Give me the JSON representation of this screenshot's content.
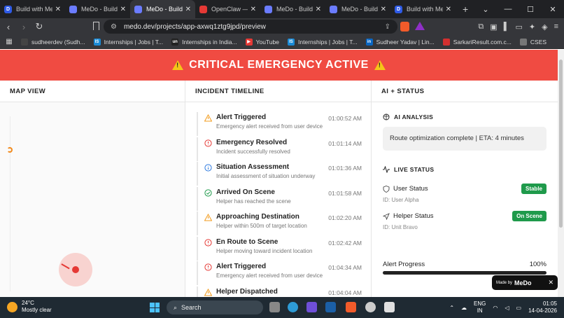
{
  "browser": {
    "tabs": [
      {
        "title": "Build with MeDo |",
        "fav_color": "#2f5be7",
        "fav_letter": "D",
        "active": false
      },
      {
        "title": "MeDo - Build full-",
        "fav_color": "#6b7cff",
        "fav_letter": "",
        "active": false
      },
      {
        "title": "MeDo - Build",
        "fav_color": "#6b7cff",
        "fav_letter": "",
        "active": true
      },
      {
        "title": "OpenClaw — Perso",
        "fav_color": "#e53935",
        "fav_letter": "",
        "active": false
      },
      {
        "title": "MeDo - Build full-",
        "fav_color": "#6b7cff",
        "fav_letter": "",
        "active": false
      },
      {
        "title": "MeDo - Build full-",
        "fav_color": "#6b7cff",
        "fav_letter": "",
        "active": false
      },
      {
        "title": "Build with MeDo |",
        "fav_color": "#2f5be7",
        "fav_letter": "D",
        "active": false
      }
    ],
    "url": "medo.dev/projects/app-axwq1ztg9jpd/preview",
    "bookmarks": [
      {
        "label": "sudheerdev (Sudh...",
        "color": "#444",
        "letter": ""
      },
      {
        "label": "Internships | Jobs | T...",
        "color": "#1a8ad6",
        "letter": "IS"
      },
      {
        "label": "Internships in India...",
        "color": "#222",
        "letter": "un"
      },
      {
        "label": "YouTube",
        "color": "#e53935",
        "letter": "▶"
      },
      {
        "label": "Internships | Jobs | T...",
        "color": "#1a8ad6",
        "letter": "IS"
      },
      {
        "label": "Sudheer Yadav | Lin...",
        "color": "#0a66c2",
        "letter": "in"
      },
      {
        "label": "SarkariResult.com.c...",
        "color": "#d32f2f",
        "letter": ""
      },
      {
        "label": "CSES",
        "color": "#777",
        "letter": ""
      }
    ]
  },
  "banner": {
    "text": "CRITICAL EMERGENCY ACTIVE"
  },
  "panels": {
    "map_title": "MAP VIEW",
    "timeline_title": "INCIDENT TIMELINE",
    "status_title": "AI + STATUS"
  },
  "timeline": [
    {
      "title": "Alert Triggered",
      "desc": "Emergency alert received from user device",
      "time": "01:00:52 AM",
      "icon": "warning-icon",
      "color": "#f29b1c"
    },
    {
      "title": "Emergency Resolved",
      "desc": "Incident successfully resolved",
      "time": "01:01:14 AM",
      "icon": "alert-circle-icon",
      "color": "#e53935"
    },
    {
      "title": "Situation Assessment",
      "desc": "Initial assessment of situation underway",
      "time": "01:01:36 AM",
      "icon": "info-icon",
      "color": "#2f7be0"
    },
    {
      "title": "Arrived On Scene",
      "desc": "Helper has reached the scene",
      "time": "01:01:58 AM",
      "icon": "check-circle-icon",
      "color": "#1f9a4b"
    },
    {
      "title": "Approaching Destination",
      "desc": "Helper within 500m of target location",
      "time": "01:02:20 AM",
      "icon": "warning-icon",
      "color": "#f29b1c"
    },
    {
      "title": "En Route to Scene",
      "desc": "Helper moving toward incident location",
      "time": "01:02:42 AM",
      "icon": "alert-circle-icon",
      "color": "#e53935"
    },
    {
      "title": "Alert Triggered",
      "desc": "Emergency alert received from user device",
      "time": "01:04:34 AM",
      "icon": "alert-circle-icon",
      "color": "#e53935"
    },
    {
      "title": "Helper Dispatched",
      "desc": "",
      "time": "01:04:04 AM",
      "icon": "warning-icon",
      "color": "#f29b1c"
    }
  ],
  "ai": {
    "analysis_title": "AI ANALYSIS",
    "analysis_text": "Route optimization complete | ETA: 4 minutes",
    "live_title": "LIVE STATUS",
    "user_label": "User Status",
    "user_id": "ID: User Alpha",
    "user_badge": "Stable",
    "helper_label": "Helper Status",
    "helper_id": "ID: Unit Bravo",
    "helper_badge": "On Scene",
    "progress_label": "Alert Progress",
    "progress_text": "100%",
    "progress_value": 1.0
  },
  "madeby": {
    "prefix": "Made by",
    "brand": "MeDo"
  },
  "taskbar": {
    "temp": "24°C",
    "weather": "Mostly clear",
    "search": "Search",
    "lang1": "ENG",
    "lang2": "IN",
    "time": "01:05",
    "date": "14-04-2026"
  }
}
